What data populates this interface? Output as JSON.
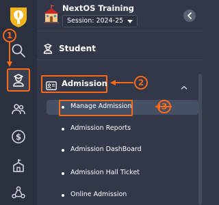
{
  "rail": {
    "icons": [
      "logo-icon",
      "search-icon",
      "student-icon",
      "people-icon",
      "dollar-icon",
      "school-icon",
      "network-icon"
    ]
  },
  "header": {
    "school_name": "NextOS Training",
    "session": "Session: 2024-25"
  },
  "section": {
    "label": "Student"
  },
  "menu": {
    "admission_label": "Admission",
    "items": [
      {
        "label": "Manage Admission",
        "active": true
      },
      {
        "label": "Admission Reports"
      },
      {
        "label": "Admission DashBoard"
      },
      {
        "label": "Admission Hall Ticket"
      },
      {
        "label": "Online Admission"
      }
    ]
  },
  "annotations": {
    "step1": "1",
    "step2": "2",
    "step3": "3"
  },
  "colors": {
    "accent": "#ff6a1a",
    "panel": "#323848",
    "rail": "#2a303e",
    "active_item": "#465064"
  }
}
